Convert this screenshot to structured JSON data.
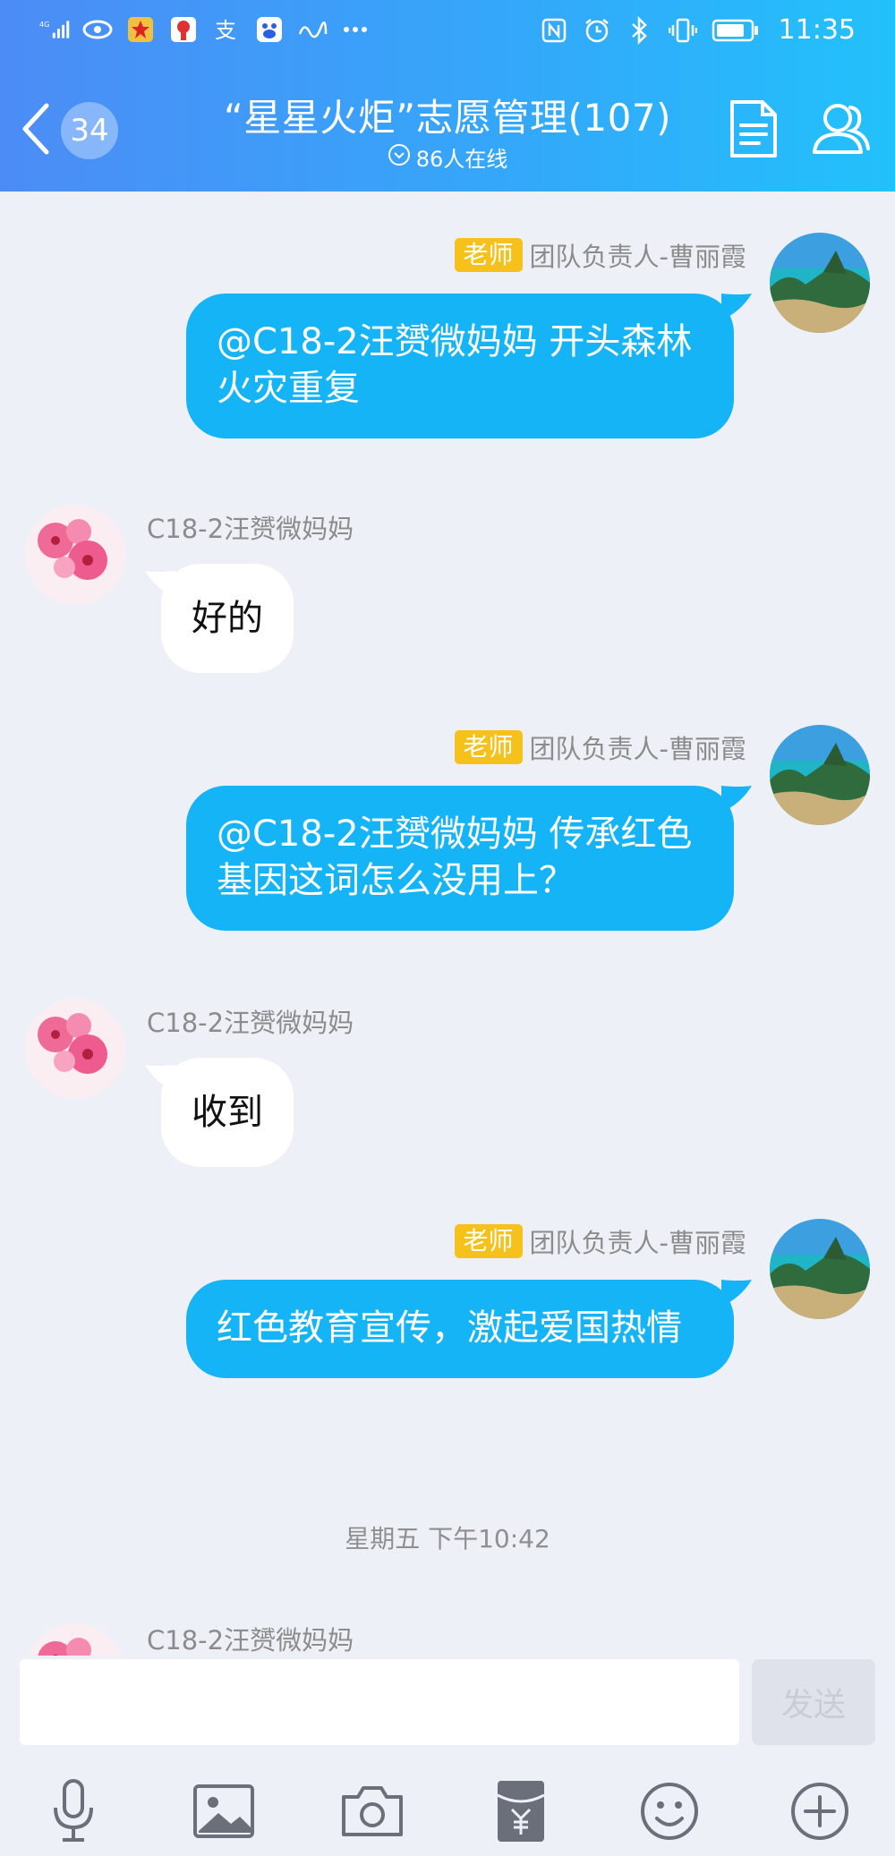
{
  "status_bar": {
    "network": "4G",
    "time": "11:35"
  },
  "header": {
    "unread_count": "34",
    "title": "“星星火炬”志愿管理(107)",
    "online": "86人在线"
  },
  "messages": [
    {
      "side": "right",
      "role_badge": "老师",
      "sender": "团队负责人-曹丽霞",
      "text": "@C18-2汪赟微妈妈 开头森林火灾重复"
    },
    {
      "side": "left",
      "sender": "C18-2汪赟微妈妈",
      "text": "好的"
    },
    {
      "side": "right",
      "role_badge": "老师",
      "sender": "团队负责人-曹丽霞",
      "text": "@C18-2汪赟微妈妈 传承红色基因这词怎么没用上？"
    },
    {
      "side": "left",
      "sender": "C18-2汪赟微妈妈",
      "text": "收到"
    },
    {
      "side": "right",
      "role_badge": "老师",
      "sender": "团队负责人-曹丽霞",
      "text": "红色教育宣传，激起爱国热情"
    }
  ],
  "timestamp": "星期五 下午10:42",
  "partial_message": {
    "sender": "C18-2汪赟微妈妈"
  },
  "input": {
    "value": "",
    "send_label": "发送"
  },
  "toolbar": [
    "microphone-icon",
    "image-icon",
    "camera-icon",
    "red-packet-icon",
    "emoji-icon",
    "plus-icon"
  ],
  "colors": {
    "header_start": "#4c8cf6",
    "header_end": "#22c1fb",
    "bubble_blue": "#15b4f6",
    "badge_yellow": "#f7c11c",
    "background": "#eef0f7"
  }
}
